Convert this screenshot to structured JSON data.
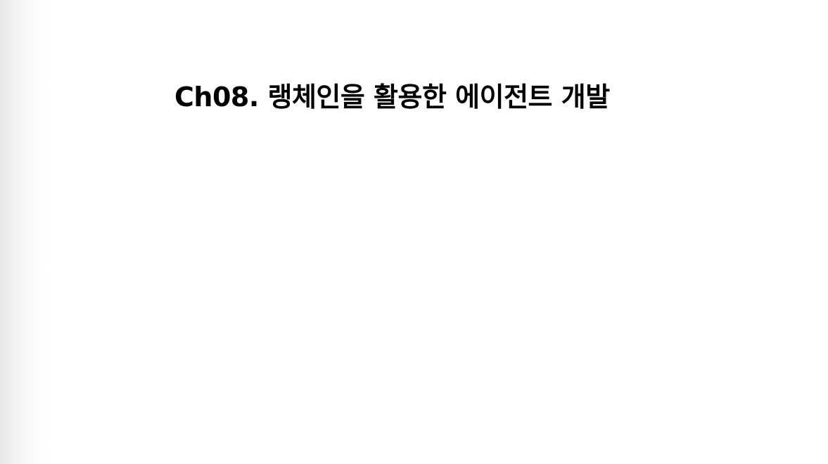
{
  "slide": {
    "title": "Ch08. 랭체인을 활용한 에이전트 개발"
  },
  "colors": {
    "background": "#ffffff",
    "text": "#000000"
  }
}
